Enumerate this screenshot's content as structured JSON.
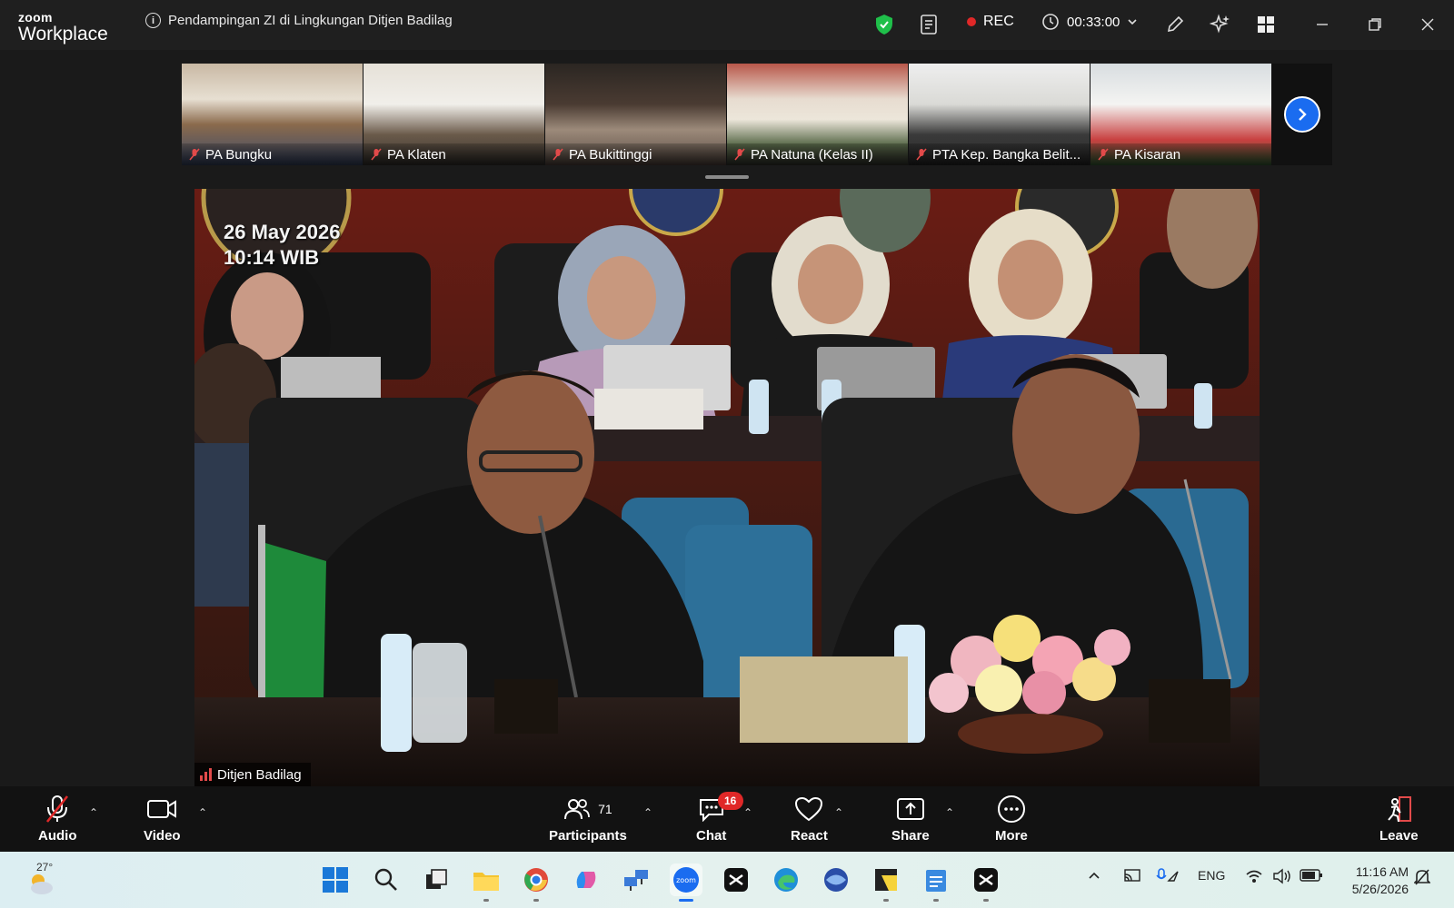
{
  "app": {
    "brand_top": "zoom",
    "brand_bottom": "Workplace"
  },
  "meeting": {
    "title": "Pendampingan ZI di Lingkungan Ditjen Badilag",
    "rec_label": "REC",
    "timer": "00:33:00"
  },
  "thumbnails": [
    {
      "name": "PA Bungku"
    },
    {
      "name": "PA Klaten"
    },
    {
      "name": "PA Bukittinggi"
    },
    {
      "name": "PA Natuna (Kelas II)"
    },
    {
      "name": "PTA Kep. Bangka Belit..."
    },
    {
      "name": "PA Kisaran"
    }
  ],
  "main_video": {
    "date": "26 May 2026",
    "time": "10:14 WIB",
    "speaker": "Ditjen Badilag"
  },
  "toolbar": {
    "audio": "Audio",
    "video": "Video",
    "participants": "Participants",
    "participants_count": "71",
    "chat": "Chat",
    "chat_badge": "16",
    "react": "React",
    "share": "Share",
    "more": "More",
    "leave": "Leave"
  },
  "taskbar": {
    "weather_temp": "27°",
    "language": "ENG",
    "time": "11:16 AM",
    "date": "5/26/2026"
  },
  "colors": {
    "accent": "#1a6cf0",
    "rec": "#e02828",
    "shield": "#1fbf4a"
  }
}
